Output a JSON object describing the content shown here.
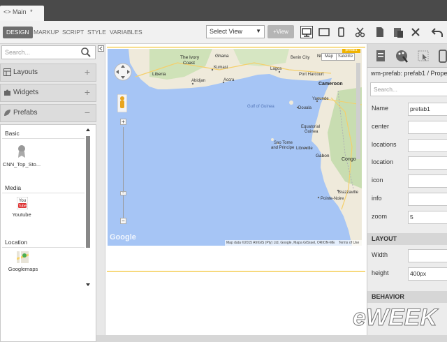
{
  "tab": {
    "icon": "code-icon",
    "label": "Main",
    "modified_marker": "*"
  },
  "toolbar": {
    "modes": [
      "DESIGN",
      "MARKUP",
      "SCRIPT",
      "STYLE",
      "VARIABLES"
    ],
    "active_mode": "DESIGN",
    "select_view": "Select View",
    "add_view": "+View",
    "tools": [
      "desktop-icon",
      "tablet-icon",
      "phone-icon",
      "cut-icon",
      "copy-icon",
      "paste-icon",
      "delete-icon",
      "undo-icon"
    ]
  },
  "left_panel": {
    "search_placeholder": "Search...",
    "sections": [
      {
        "label": "Layouts",
        "toggle": "+",
        "icon": "layouts-icon"
      },
      {
        "label": "Widgets",
        "toggle": "+",
        "icon": "puzzle-icon"
      },
      {
        "label": "Prefabs",
        "toggle": "−",
        "icon": "leaf-icon"
      }
    ],
    "groups": [
      {
        "name": "Basic",
        "items": [
          {
            "label": "CNN_Top_Sto...",
            "icon": "award-icon"
          }
        ]
      },
      {
        "name": "Media",
        "items": [
          {
            "label": "Youtube",
            "icon": "youtube-icon"
          }
        ]
      },
      {
        "name": "Location",
        "items": [
          {
            "label": "Googlemaps",
            "icon": "googlemaps-icon"
          }
        ]
      }
    ]
  },
  "map": {
    "type_buttons": [
      "Map",
      "Satellite"
    ],
    "badge": "prefab1",
    "labels": [
      "The Ivory Coast",
      "Ghana",
      "Liberia",
      "Kumasi",
      "Abidjan",
      "Accra",
      "Lagos",
      "Nigeria",
      "Benin City",
      "Port Harcourt",
      "Cameroon",
      "Yaounde",
      "Douala",
      "Gulf of Guinea",
      "Equatorial Guinea",
      "Sao Tome and Principe",
      "Libreville",
      "Gabon",
      "Congo",
      "Brazzaville",
      "Pointe-Noire"
    ],
    "attribution": "Map data ©2015 AfriGIS (Pty) Ltd, Google, Mapa GISrael, ORION-ME",
    "terms": "Terms of Use",
    "logo": "Google"
  },
  "right_panel": {
    "tabs": [
      "properties-icon",
      "styles-icon",
      "events-icon",
      "device-icon"
    ],
    "title": "wm-prefab: prefab1 / Prope",
    "search_placeholder": "Search...",
    "properties": [
      {
        "label": "Name",
        "value": "prefab1"
      },
      {
        "label": "center",
        "value": ""
      },
      {
        "label": "locations",
        "value": ""
      },
      {
        "label": "location",
        "value": ""
      },
      {
        "label": "icon",
        "value": ""
      },
      {
        "label": "info",
        "value": ""
      },
      {
        "label": "zoom",
        "value": "5"
      }
    ],
    "layout_section": "LAYOUT",
    "layout_properties": [
      {
        "label": "Width",
        "value": ""
      },
      {
        "label": "height",
        "value": "400px"
      }
    ],
    "behavior_section": "BEHAVIOR"
  },
  "watermark": "eWEEK",
  "colors": {
    "tabbar": "#4a4a4a",
    "accent": "#f0b400",
    "water": "#a6c5f5",
    "land": "#efeadb"
  }
}
